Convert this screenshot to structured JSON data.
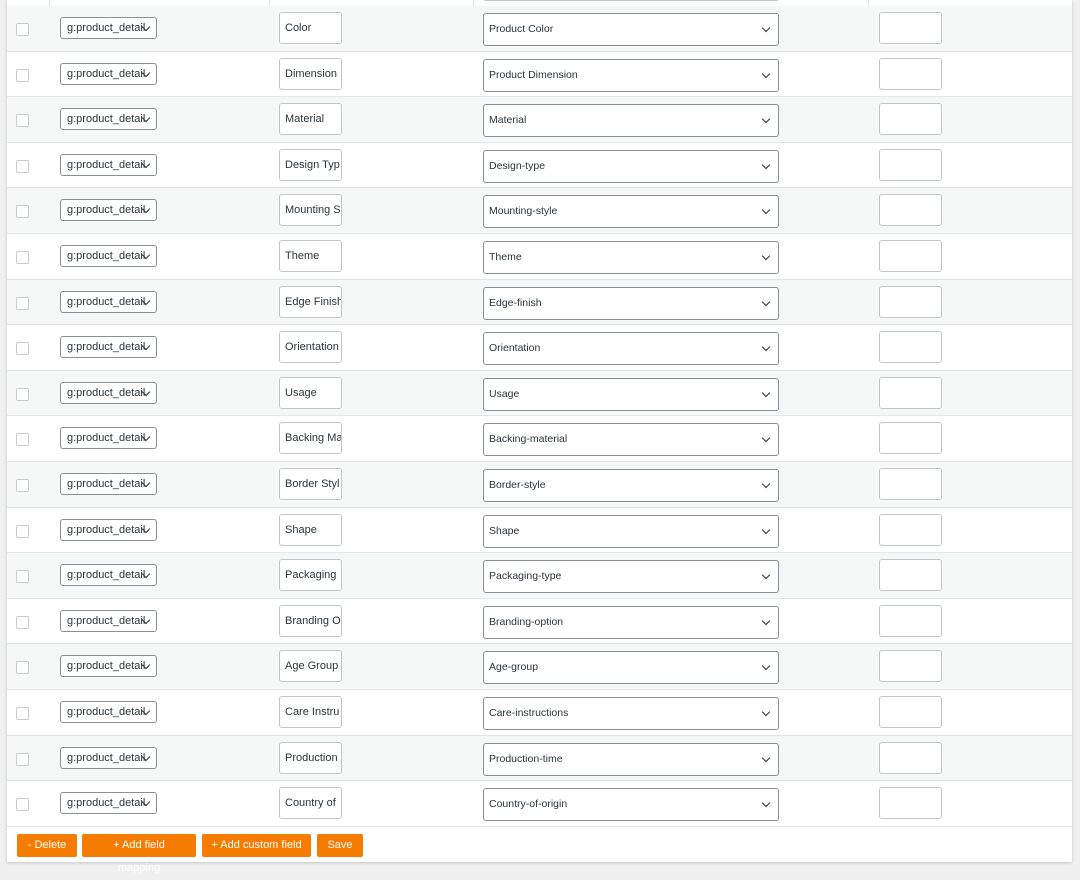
{
  "icons": {
    "row_checkbox": "checkbox-icon",
    "dropdown": "chevron-down-icon"
  },
  "colors": {
    "button_bg": "#f57c00",
    "button_text": "#ffffff"
  },
  "rows": [
    {
      "prefix": "g:product_detail",
      "label": "Color",
      "attribute": "Product Color"
    },
    {
      "prefix": "g:product_detail",
      "label": "Dimension",
      "attribute": "Product Dimension"
    },
    {
      "prefix": "g:product_detail",
      "label": "Material",
      "attribute": "Material"
    },
    {
      "prefix": "g:product_detail",
      "label": "Design Typ",
      "attribute": "Design-type"
    },
    {
      "prefix": "g:product_detail",
      "label": "Mounting S",
      "attribute": "Mounting-style"
    },
    {
      "prefix": "g:product_detail",
      "label": "Theme",
      "attribute": "Theme"
    },
    {
      "prefix": "g:product_detail",
      "label": "Edge Finish",
      "attribute": "Edge-finish"
    },
    {
      "prefix": "g:product_detail",
      "label": "Orientation",
      "attribute": "Orientation"
    },
    {
      "prefix": "g:product_detail",
      "label": "Usage",
      "attribute": "Usage"
    },
    {
      "prefix": "g:product_detail",
      "label": "Backing Ma",
      "attribute": "Backing-material"
    },
    {
      "prefix": "g:product_detail",
      "label": "Border Styl",
      "attribute": "Border-style"
    },
    {
      "prefix": "g:product_detail",
      "label": "Shape",
      "attribute": "Shape"
    },
    {
      "prefix": "g:product_detail",
      "label": "Packaging",
      "attribute": "Packaging-type"
    },
    {
      "prefix": "g:product_detail",
      "label": "Branding O",
      "attribute": "Branding-option"
    },
    {
      "prefix": "g:product_detail",
      "label": "Age Group",
      "attribute": "Age-group"
    },
    {
      "prefix": "g:product_detail",
      "label": "Care Instru",
      "attribute": "Care-instructions"
    },
    {
      "prefix": "g:product_detail",
      "label": "Production",
      "attribute": "Production-time"
    },
    {
      "prefix": "g:product_detail",
      "label": "Country of",
      "attribute": "Country-of-origin"
    }
  ],
  "footer": {
    "delete_label": "- Delete",
    "add_mapping_label": "+ Add field mapping",
    "add_custom_label": "+ Add custom field",
    "save_label": "Save"
  }
}
